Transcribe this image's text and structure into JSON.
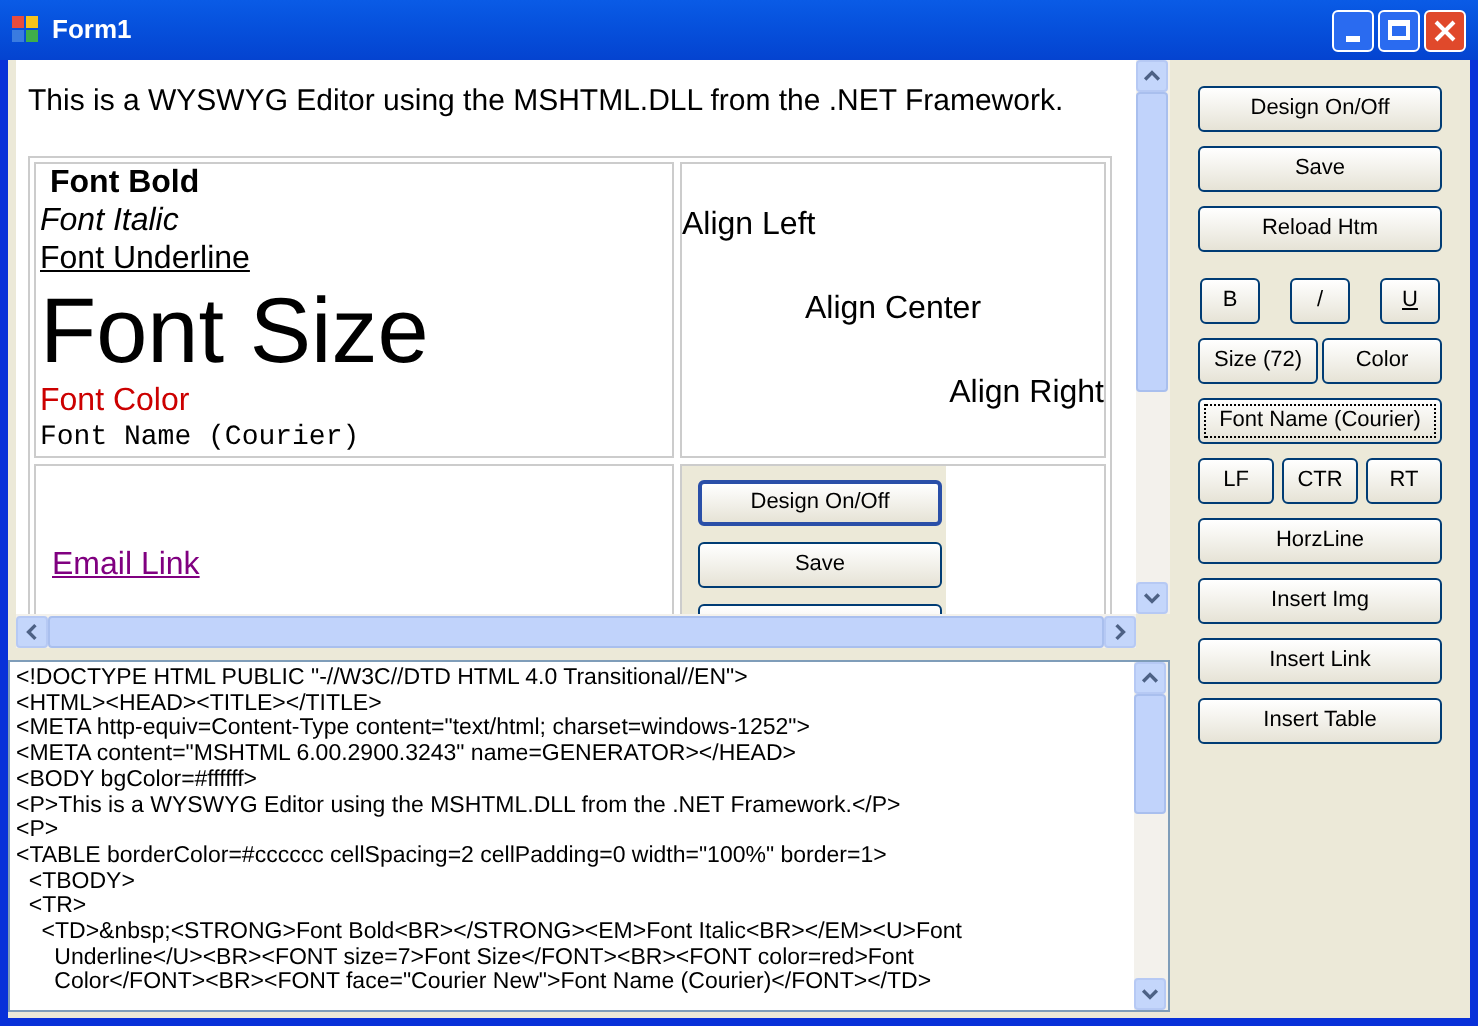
{
  "window": {
    "title": "Form1"
  },
  "editor": {
    "intro": "This is a WYSWYG Editor using the MSHTML.DLL from the .NET Framework.",
    "formatting": [
      {
        "kind": "bold",
        "text": "Font Bold"
      },
      {
        "kind": "italic",
        "text": "Font Italic"
      },
      {
        "kind": "underline",
        "text": "Font Underline"
      },
      {
        "kind": "size",
        "text": "Font Size"
      },
      {
        "kind": "color",
        "text": "Font Color",
        "color": "#cc0000"
      },
      {
        "kind": "mono",
        "text": "Font Name (Courier)"
      }
    ],
    "alignments": [
      {
        "kind": "left",
        "text": "Align Left"
      },
      {
        "kind": "center",
        "text": "Align Center"
      },
      {
        "kind": "right",
        "text": "Align Right"
      }
    ],
    "link": "Email Link",
    "embedded_buttons": [
      {
        "label": "Design On/Off",
        "focused": true
      },
      {
        "label": "Save",
        "focused": false
      }
    ]
  },
  "source": {
    "lines": [
      "<!DOCTYPE HTML PUBLIC \"-//W3C//DTD HTML 4.0 Transitional//EN\">",
      "<HTML><HEAD><TITLE></TITLE>",
      "<META http-equiv=Content-Type content=\"text/html; charset=windows-1252\">",
      "<META content=\"MSHTML 6.00.2900.3243\" name=GENERATOR></HEAD>",
      "<BODY bgColor=#ffffff>",
      "<P>This is a WYSWYG Editor using the MSHTML.DLL from the .NET Framework.</P>",
      "<P>",
      "<TABLE borderColor=#cccccc cellSpacing=2 cellPadding=0 width=\"100%\" border=1>",
      "  <TBODY>",
      "  <TR>",
      "    <TD>&nbsp;<STRONG>Font Bold<BR></STRONG><EM>Font Italic<BR></EM><U>Font",
      "      Underline</U><BR><FONT size=7>Font Size</FONT><BR><FONT color=red>Font",
      "      Color</FONT><BR><FONT face=\"Courier New\">Font Name (Courier)</FONT></TD>"
    ]
  },
  "toolbar": {
    "rows": [
      [
        {
          "label": "Design On/Off",
          "focused": false,
          "underline": false
        }
      ],
      [
        {
          "label": "Save",
          "focused": false,
          "underline": false
        }
      ],
      [
        {
          "label": "Reload Htm",
          "focused": false,
          "underline": false
        }
      ],
      [
        {
          "label": "B",
          "focused": false,
          "underline": false
        },
        {
          "label": "/",
          "focused": false,
          "underline": false
        },
        {
          "label": "U",
          "focused": false,
          "underline": true
        }
      ],
      [
        {
          "label": "Size (72)",
          "focused": false,
          "underline": false
        },
        {
          "label": "Color",
          "focused": false,
          "underline": false
        }
      ],
      [
        {
          "label": "Font Name (Courier)",
          "focused": true,
          "underline": false
        }
      ],
      [
        {
          "label": "LF",
          "focused": false,
          "underline": false
        },
        {
          "label": "CTR",
          "focused": false,
          "underline": false
        },
        {
          "label": "RT",
          "focused": false,
          "underline": false
        }
      ],
      [
        {
          "label": "HorzLine",
          "focused": false,
          "underline": false
        }
      ],
      [
        {
          "label": "Insert Img",
          "focused": false,
          "underline": false
        }
      ],
      [
        {
          "label": "Insert Link",
          "focused": false,
          "underline": false
        }
      ],
      [
        {
          "label": "Insert Table",
          "focused": false,
          "underline": false
        }
      ]
    ]
  }
}
